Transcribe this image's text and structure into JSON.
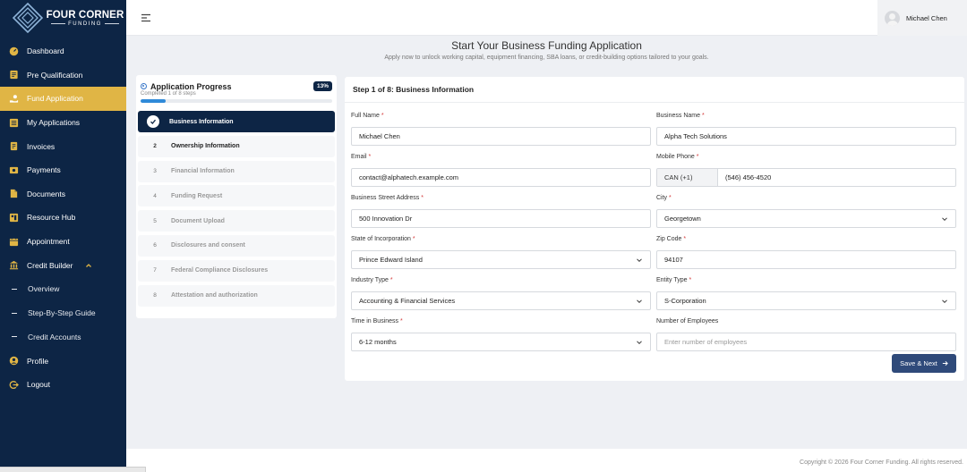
{
  "brand": {
    "name": "FOUR CORNER",
    "sub": "FUNDING"
  },
  "sidebar": {
    "items": [
      {
        "label": "Dashboard",
        "icon": "dashboard-icon"
      },
      {
        "label": "Pre Qualification",
        "icon": "document-icon"
      },
      {
        "label": "Fund Application",
        "icon": "hand-coins-icon",
        "active": true
      },
      {
        "label": "My Applications",
        "icon": "list-icon"
      },
      {
        "label": "Invoices",
        "icon": "invoice-icon"
      },
      {
        "label": "Payments",
        "icon": "payment-icon"
      },
      {
        "label": "Documents",
        "icon": "folder-icon"
      },
      {
        "label": "Resource Hub",
        "icon": "hub-icon"
      },
      {
        "label": "Appointment",
        "icon": "calendar-icon"
      },
      {
        "label": "Credit Builder",
        "icon": "bank-icon"
      }
    ],
    "credit_builder_sub": [
      {
        "label": "Overview"
      },
      {
        "label": "Step-By-Step Guide"
      },
      {
        "label": "Credit Accounts"
      }
    ],
    "bottom_items": [
      {
        "label": "Profile",
        "icon": "profile-icon"
      },
      {
        "label": "Logout",
        "icon": "logout-icon"
      }
    ]
  },
  "topbar": {
    "user_name": "Michael Chen"
  },
  "page": {
    "title": "Start Your Business Funding Application",
    "subtitle": "Apply now to unlock working capital, equipment financing, SBA loans, or credit-building options tailored to your goals."
  },
  "progress": {
    "title": "Application Progress",
    "badge": "13%",
    "percent": 13,
    "completed": "Completed 1 of 8 steps",
    "steps": [
      {
        "num": "1",
        "label": "Business Information",
        "state": "done"
      },
      {
        "num": "2",
        "label": "Ownership Information",
        "state": "current"
      },
      {
        "num": "3",
        "label": "Financial Information",
        "state": "todo"
      },
      {
        "num": "4",
        "label": "Funding Request",
        "state": "todo"
      },
      {
        "num": "5",
        "label": "Document Upload",
        "state": "todo"
      },
      {
        "num": "6",
        "label": "Disclosures and consent",
        "state": "todo"
      },
      {
        "num": "7",
        "label": "Federal Compliance Disclosures",
        "state": "todo"
      },
      {
        "num": "8",
        "label": "Attestation and authorization",
        "state": "todo"
      }
    ]
  },
  "form": {
    "title": "Step 1 of 8: Business Information",
    "full_name": {
      "label": "Full Name",
      "value": "Michael Chen"
    },
    "business_name": {
      "label": "Business Name",
      "value": "Alpha Tech Solutions"
    },
    "email": {
      "label": "Email",
      "value": "contact@alphatech.example.com"
    },
    "mobile_phone": {
      "label": "Mobile Phone",
      "code": "CAN (+1)",
      "value": "(546) 456-4520"
    },
    "street": {
      "label": "Business Street Address",
      "value": "500 Innovation Dr"
    },
    "city": {
      "label": "City",
      "value": "Georgetown"
    },
    "state": {
      "label": "State of Incorporation",
      "value": "Prince Edward Island"
    },
    "zip": {
      "label": "Zip Code",
      "value": "94107"
    },
    "industry": {
      "label": "Industry Type",
      "value": "Accounting & Financial Services"
    },
    "entity": {
      "label": "Entity Type",
      "value": "S-Corporation"
    },
    "time_in_business": {
      "label": "Time in Business",
      "value": "6-12 months"
    },
    "employees": {
      "label": "Number of Employees",
      "placeholder": "Enter number of employees"
    },
    "required_mark": "*",
    "save_label": "Save & Next"
  },
  "footer": {
    "text": "Copyright © 2026 Four Corner Funding. All rights reserved."
  },
  "colors": {
    "sidebar": "#0d2545",
    "accent": "#e0b545",
    "button": "#2f4a7a",
    "progress": "#2f8ad9"
  }
}
